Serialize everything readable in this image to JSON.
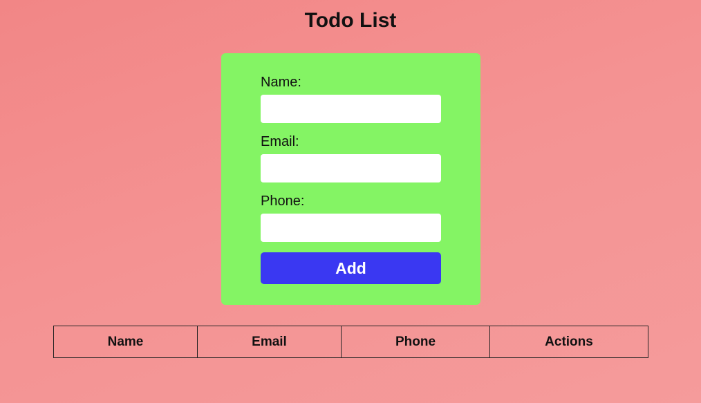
{
  "page": {
    "title": "Todo List"
  },
  "form": {
    "name_label": "Name:",
    "name_value": "",
    "email_label": "Email:",
    "email_value": "",
    "phone_label": "Phone:",
    "phone_value": "",
    "add_label": "Add"
  },
  "table": {
    "columns": [
      "Name",
      "Email",
      "Phone",
      "Actions"
    ],
    "rows": []
  },
  "colors": {
    "background": "#f48d8d",
    "form_background": "#84f464",
    "button": "#3a38f2",
    "button_text": "#ffffff"
  }
}
